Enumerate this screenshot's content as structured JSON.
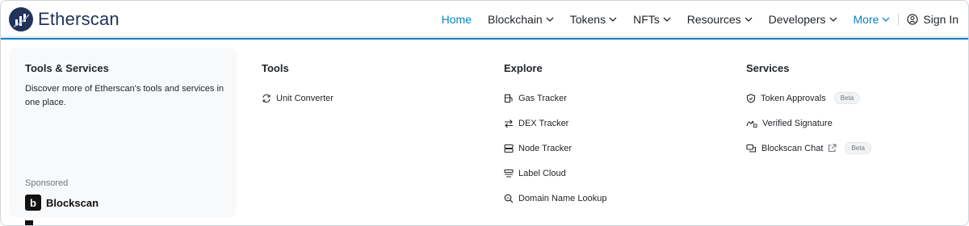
{
  "brand": {
    "name": "Etherscan"
  },
  "nav": {
    "items": [
      {
        "label": "Home",
        "active": true,
        "chevron": false
      },
      {
        "label": "Blockchain",
        "active": false,
        "chevron": true
      },
      {
        "label": "Tokens",
        "active": false,
        "chevron": true
      },
      {
        "label": "NFTs",
        "active": false,
        "chevron": true
      },
      {
        "label": "Resources",
        "active": false,
        "chevron": true
      },
      {
        "label": "Developers",
        "active": false,
        "chevron": true
      },
      {
        "label": "More",
        "active": true,
        "chevron": true
      }
    ],
    "sign_in": "Sign In"
  },
  "menu": {
    "side": {
      "title": "Tools & Services",
      "description": "Discover more of Etherscan's tools and services in one place.",
      "sponsored_label": "Sponsored",
      "sponsor_logo_letter": "b",
      "sponsor_name": "Blockscan"
    },
    "tools": {
      "title": "Tools",
      "items": [
        {
          "label": "Unit Converter",
          "icon": "refresh-icon"
        }
      ]
    },
    "explore": {
      "title": "Explore",
      "items": [
        {
          "label": "Gas Tracker",
          "icon": "gas-pump-icon"
        },
        {
          "label": "DEX Tracker",
          "icon": "swap-arrows-icon"
        },
        {
          "label": "Node Tracker",
          "icon": "server-icon"
        },
        {
          "label": "Label Cloud",
          "icon": "tags-icon"
        },
        {
          "label": "Domain Name Lookup",
          "icon": "magnifier-icon"
        }
      ]
    },
    "services": {
      "title": "Services",
      "items": [
        {
          "label": "Token Approvals",
          "icon": "shield-icon",
          "badge": "Beta"
        },
        {
          "label": "Verified Signature",
          "icon": "signature-icon"
        },
        {
          "label": "Blockscan Chat",
          "icon": "chat-icon",
          "badge": "Beta"
        }
      ]
    }
  },
  "colors": {
    "accent": "#0784c3",
    "brand": "#21325b",
    "text": "#212529",
    "card": "#f8f9fa"
  }
}
